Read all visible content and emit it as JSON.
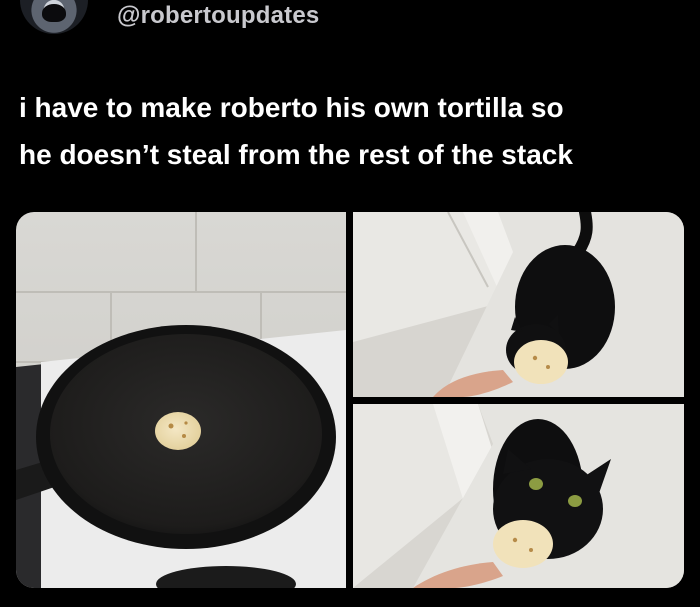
{
  "author": {
    "handle": "@robertoupdates",
    "avatar_icon": "avatar-icon"
  },
  "tweet": {
    "text_lines": [
      "i have to make roberto his own tortilla so",
      "he doesn’t steal from the rest of the stack"
    ]
  },
  "media": {
    "photo_count": 3,
    "colors": {
      "background": "#000000",
      "handle": "#c9c9ce",
      "text": "#ffffff"
    }
  }
}
